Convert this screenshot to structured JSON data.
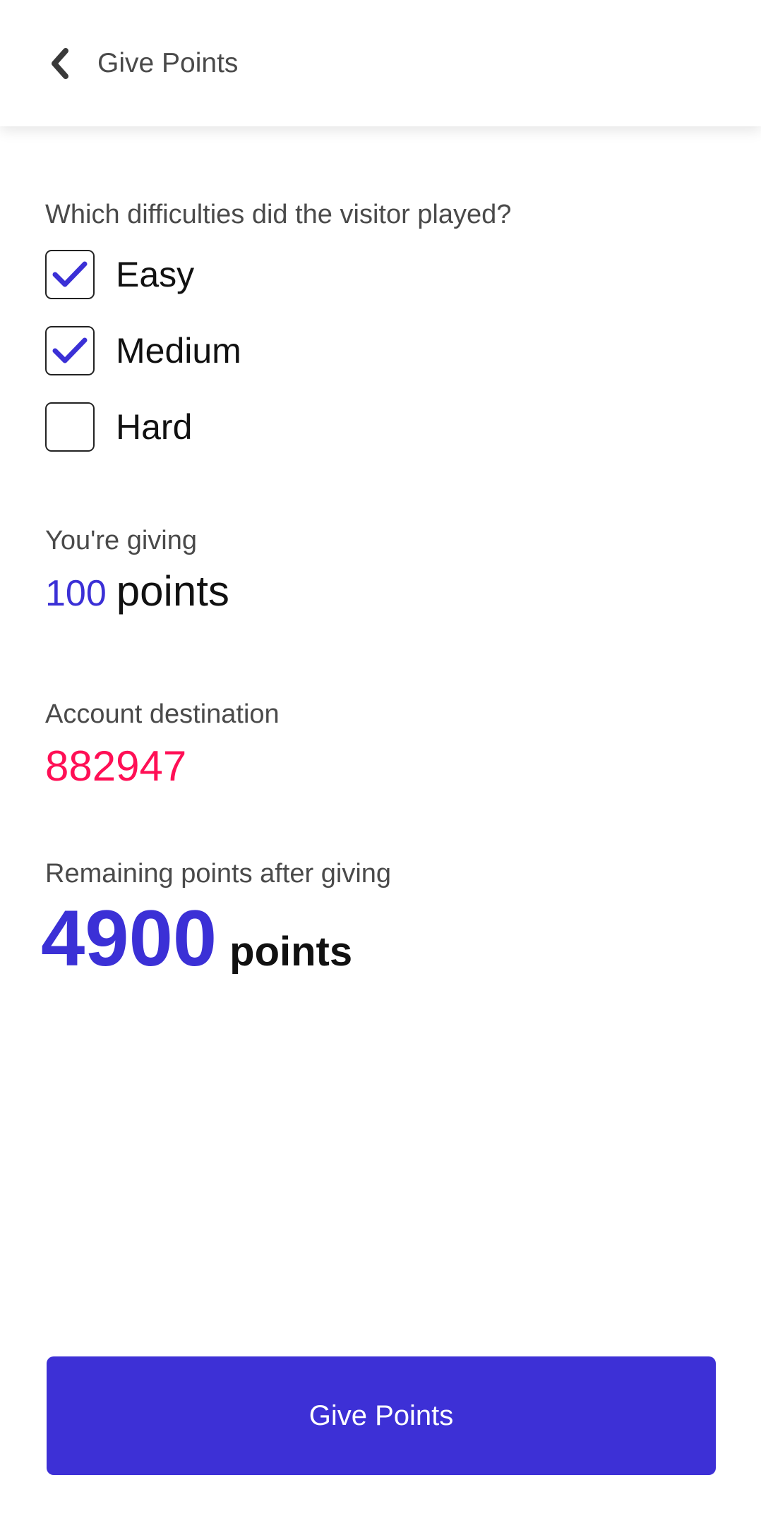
{
  "app_bar": {
    "title": "Give Points",
    "back_icon": "chevron-left-icon"
  },
  "difficulty": {
    "question": "Which difficulties did the visitor played?",
    "options": [
      {
        "label": "Easy",
        "checked": true
      },
      {
        "label": "Medium",
        "checked": true
      },
      {
        "label": "Hard",
        "checked": false
      }
    ]
  },
  "giving": {
    "label": "You're giving",
    "amount": "100",
    "unit": "points"
  },
  "account": {
    "label": "Account destination",
    "number": "882947"
  },
  "remaining": {
    "label": "Remaining points after giving",
    "amount": "4900",
    "unit": "points"
  },
  "action": {
    "button_label": "Give Points"
  },
  "colors": {
    "accent": "#3d30d6",
    "account_number": "#ff0f55",
    "checkmark": "#3b30d6"
  }
}
